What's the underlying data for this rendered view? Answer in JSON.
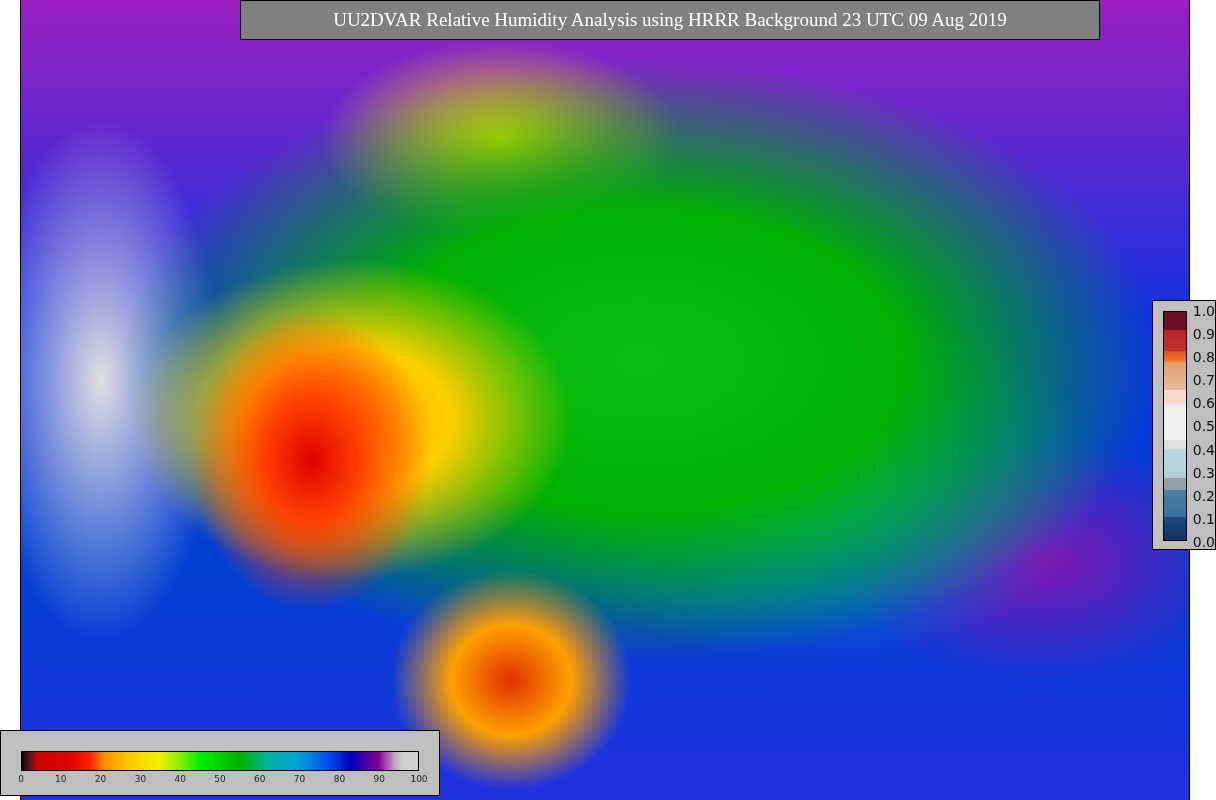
{
  "title": "UU2DVAR Relative Humidity Analysis using HRRR Background 23 UTC 09 Aug 2019",
  "side_colorbar": {
    "ticks": [
      "1.0",
      "0.9",
      "0.8",
      "0.7",
      "0.6",
      "0.5",
      "0.4",
      "0.3",
      "0.2",
      "0.1",
      "0.0"
    ]
  },
  "bottom_colorbar": {
    "ticks": [
      "0",
      "10",
      "20",
      "30",
      "40",
      "50",
      "60",
      "70",
      "80",
      "90",
      "100"
    ]
  }
}
